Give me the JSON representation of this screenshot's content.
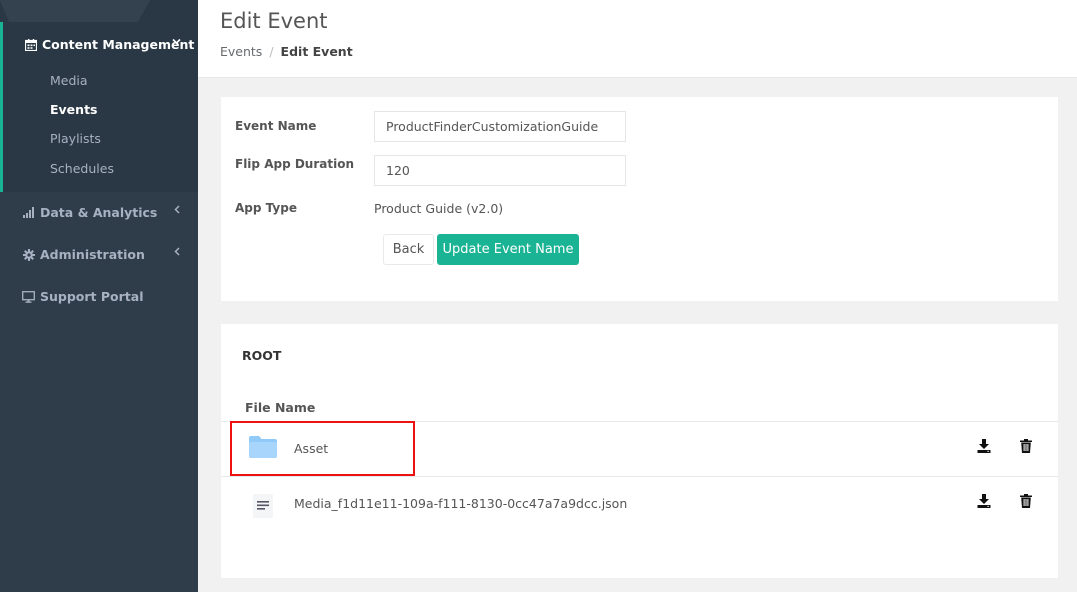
{
  "sidebar": {
    "content_management": {
      "label": "Content Management",
      "icon": "calendar-icon",
      "items": [
        {
          "label": "Media",
          "active": false
        },
        {
          "label": "Events",
          "active": true
        },
        {
          "label": "Playlists",
          "active": false
        },
        {
          "label": "Schedules",
          "active": false
        }
      ]
    },
    "data_analytics": {
      "label": "Data & Analytics",
      "icon": "bar-chart-icon"
    },
    "administration": {
      "label": "Administration",
      "icon": "gear-icon"
    },
    "support_portal": {
      "label": "Support Portal",
      "icon": "monitor-icon"
    }
  },
  "header": {
    "title": "Edit Event",
    "breadcrumb": {
      "parent": "Events",
      "separator": "/",
      "current": "Edit Event"
    }
  },
  "form": {
    "event_name_label": "Event Name",
    "event_name_value": "ProductFinderCustomizationGuide",
    "flip_duration_label": "Flip App Duration",
    "flip_duration_value": "120",
    "app_type_label": "App Type",
    "app_type_value": "Product Guide (v2.0)",
    "back_label": "Back",
    "update_label": "Update Event Name"
  },
  "files": {
    "root_label": "ROOT",
    "column_header": "File Name",
    "rows": [
      {
        "name": "Asset",
        "type": "folder",
        "icon": "folder-icon"
      },
      {
        "name": "Media_f1d11e11-109a-f111-8130-0cc47a7a9dcc.json",
        "type": "file",
        "icon": "document-icon"
      }
    ]
  },
  "colors": {
    "sidebar_bg": "#2f3d4a",
    "accent": "#1ab394",
    "highlight": "#e11111",
    "folder": "#90caf9"
  }
}
